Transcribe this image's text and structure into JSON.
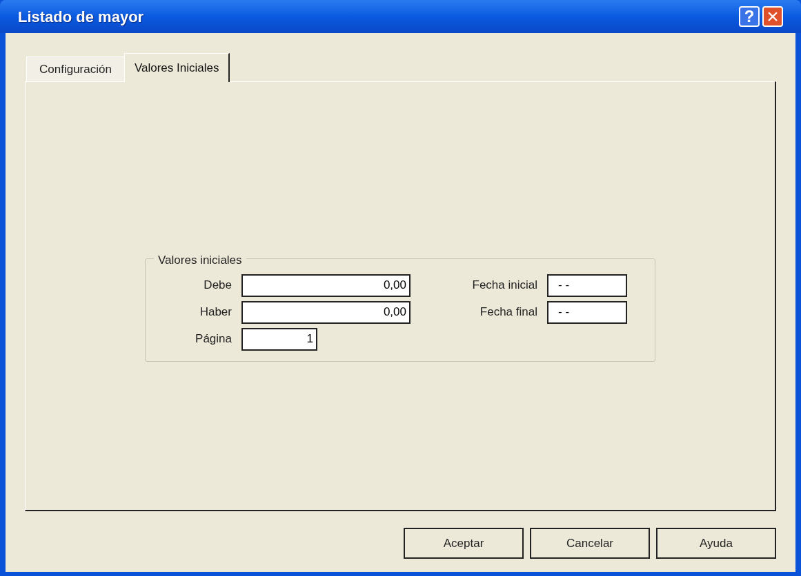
{
  "window": {
    "title": "Listado de mayor",
    "buttons": [
      {
        "kind": "help",
        "label": "?"
      },
      {
        "kind": "close",
        "label": "×"
      }
    ]
  },
  "tabs": [
    {
      "label": "Configuración",
      "selected": false
    },
    {
      "label": "Valores Iniciales",
      "selected": true
    }
  ],
  "group": {
    "title": "Valores iniciales",
    "left_fields": [
      {
        "label": "Debe",
        "value": "0,00",
        "kind": "amount"
      },
      {
        "label": "Haber",
        "value": "0,00",
        "kind": "amount"
      },
      {
        "label": "Página",
        "value": "1",
        "kind": "page"
      }
    ],
    "right_fields": [
      {
        "label": "Fecha inicial",
        "value": "- -"
      },
      {
        "label": "Fecha final",
        "value": "- -"
      }
    ]
  },
  "buttons": [
    "Aceptar",
    "Cancelar",
    "Ayuda"
  ]
}
